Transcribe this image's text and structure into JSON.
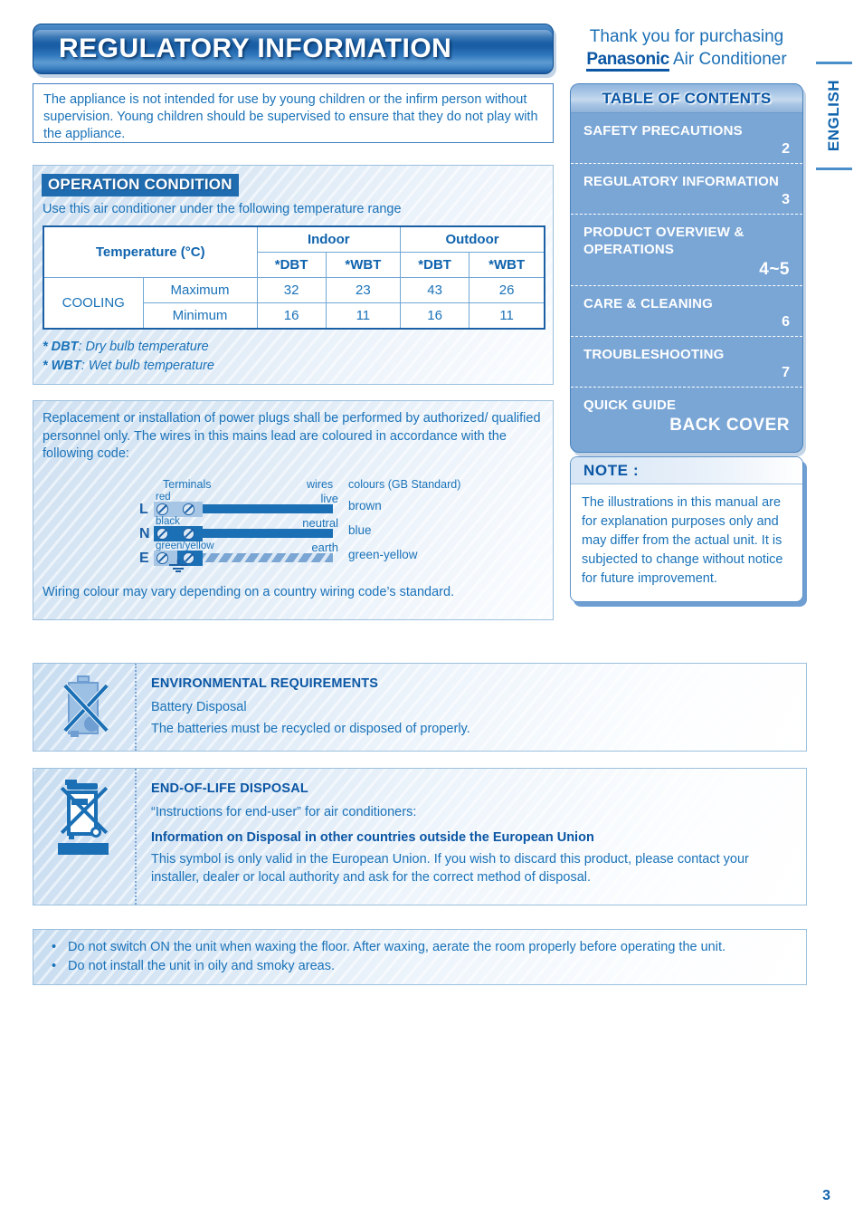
{
  "header": {
    "banner_title": "REGULATORY INFORMATION",
    "thank_you_line1": "Thank you for purchasing",
    "brand": "Panasonic",
    "product": "Air Conditioner",
    "language_tab": "ENGLISH"
  },
  "children_warning": {
    "text": "The appliance is not intended for use by young children or the infirm person without supervision. Young children should be supervised to ensure that they do not play with the appliance."
  },
  "operation_condition": {
    "heading": "OPERATION CONDITION",
    "subtitle": "Use this air conditioner under the following temperature range",
    "table": {
      "row_header": "Temperature (°C)",
      "group_headers": [
        "Indoor",
        "Outdoor"
      ],
      "sub_headers": [
        "*DBT",
        "*WBT",
        "*DBT",
        "*WBT"
      ],
      "mode_label": "COOLING",
      "rows": [
        {
          "label": "Maximum",
          "values": [
            "32",
            "23",
            "43",
            "26"
          ]
        },
        {
          "label": "Minimum",
          "values": [
            "16",
            "11",
            "16",
            "11"
          ]
        }
      ]
    },
    "footnotes": [
      {
        "abbr": "* DBT",
        "text": ":  Dry bulb temperature"
      },
      {
        "abbr": "* WBT",
        "text": ": Wet bulb temperature"
      }
    ]
  },
  "wiring": {
    "intro": "Replacement or installation of power plugs shall be performed by authorized/ qualified personnel only. The wires in this mains lead are coloured in accordance with the following code:",
    "column_headers": {
      "terminals": "Terminals",
      "wires": "wires",
      "colours": "colours (GB Standard)"
    },
    "rows": [
      {
        "letter": "L",
        "terminal": "red",
        "wire": "live",
        "colour": "brown"
      },
      {
        "letter": "N",
        "terminal": "black",
        "wire": "neutral",
        "colour": "blue"
      },
      {
        "letter": "E",
        "terminal": "green/yellow",
        "wire": "earth",
        "colour": "green-yellow"
      }
    ],
    "footer": "Wiring colour may vary depending on a country wiring code’s standard."
  },
  "toc": {
    "title": "TABLE OF CONTENTS",
    "items": [
      {
        "label": "SAFETY PRECAUTIONS",
        "page": "2",
        "big": false
      },
      {
        "label": "REGULATORY INFORMATION",
        "page": "3",
        "big": false
      },
      {
        "label": "PRODUCT OVERVIEW & OPERATIONS",
        "page": "4~5",
        "big": true
      },
      {
        "label": "CARE & CLEANING",
        "page": "6",
        "big": false
      },
      {
        "label": "TROUBLESHOOTING",
        "page": "7",
        "big": false
      },
      {
        "label": "QUICK GUIDE",
        "page": "BACK COVER",
        "big": true
      }
    ]
  },
  "note": {
    "title": "NOTE :",
    "text": "The illustrations in this manual are for explanation purposes only and may differ from the actual unit. It is subjected to change without notice for future improvement."
  },
  "environmental": {
    "heading": "ENVIRONMENTAL REQUIREMENTS",
    "line1": "Battery Disposal",
    "line2": "The batteries must be recycled or disposed of properly."
  },
  "eol": {
    "heading": "END-OF-LIFE DISPOSAL",
    "line1": "“Instructions for end-user” for air conditioners:",
    "line2_bold": "Information on Disposal in other countries outside the European Union",
    "line3": "This symbol is only valid in the European Union. If you wish to discard this product, please contact your installer, dealer or local authority and ask for the correct method of disposal."
  },
  "bullets": {
    "items": [
      "Do not switch ON the unit when waxing the floor. After waxing, aerate the room properly before operating the unit.",
      "Do not install the unit in oily and smoky areas."
    ]
  },
  "page_number": "3"
}
